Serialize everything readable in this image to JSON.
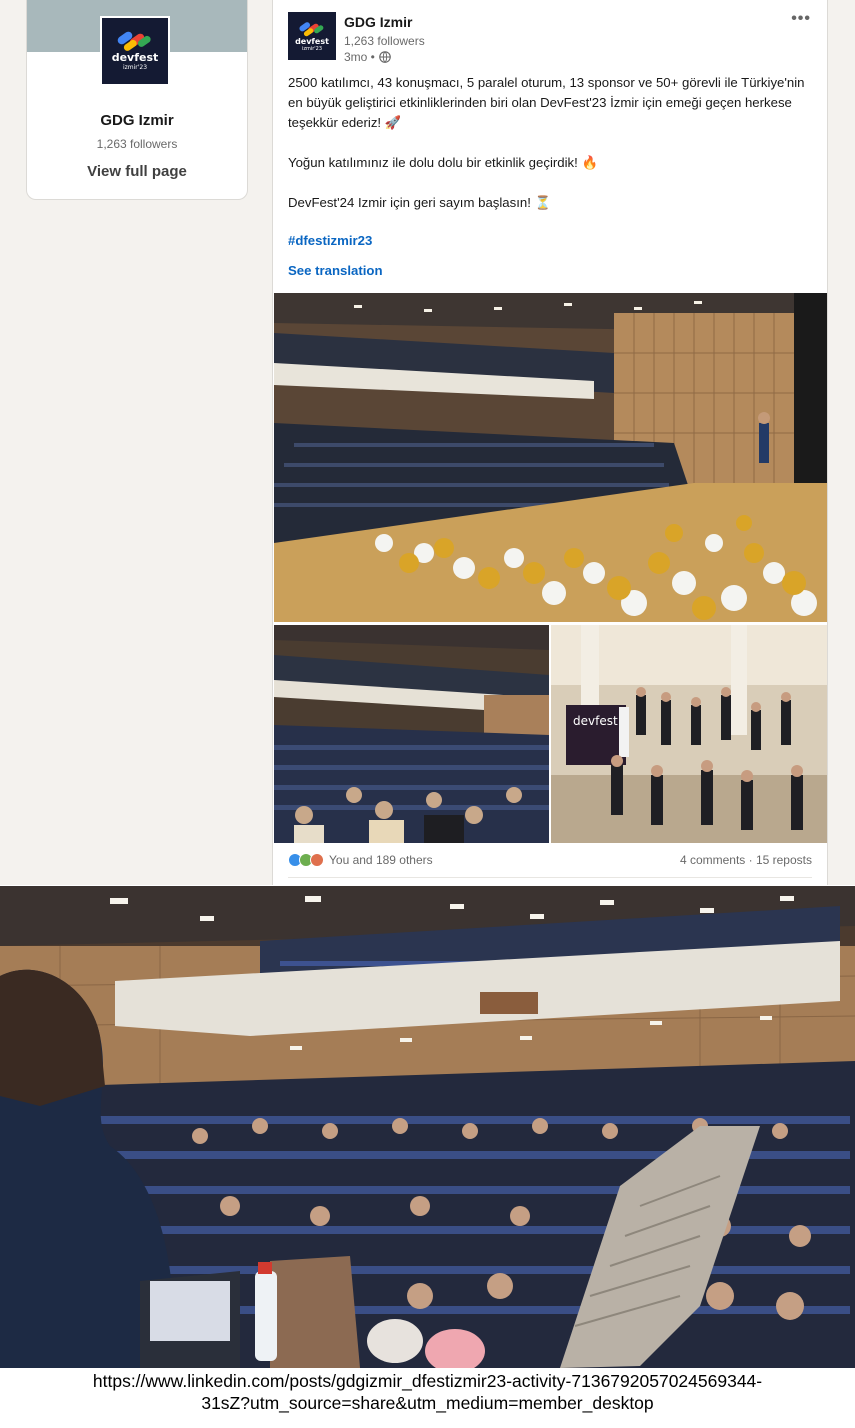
{
  "profile_card": {
    "name": "GDG Izmir",
    "followers": "1,263 followers",
    "view_link": "View full page",
    "logo_text": "devfest",
    "logo_subtext": "izmir'23"
  },
  "post": {
    "actor_name": "GDG Izmir",
    "actor_followers": "1,263 followers",
    "time": "3mo •",
    "more_label": "•••",
    "paragraphs": [
      "2500 katılımcı, 43 konuşmacı, 5 paralel oturum, 13 sponsor ve 50+ görevli ile Türkiye'nin en büyük geliştirici etkinliklerinden biri olan DevFest'23 İzmir için emeği geçen herkese teşekkür ederiz! 🚀",
      "Yoğun katılımınız ile dolu dolu bir etkinlik geçirdik! 🔥",
      "DevFest'24 Izmir için geri sayım başlasın! ⏳"
    ],
    "hashtag": "#dfestizmir23",
    "see_translation": "See translation",
    "reactions_text": "You and 189 others",
    "social_counts": "4 comments · 15 reposts",
    "images": [
      {
        "name": "auditorium-stage-balls-photo"
      },
      {
        "name": "auditorium-audience-photo"
      },
      {
        "name": "devfest-lobby-crowd-photo"
      }
    ]
  },
  "large_photo": {
    "name": "speaker-view-auditorium-photo"
  },
  "url_caption": {
    "line1": "https://www.linkedin.com/posts/gdgizmir_dfestizmir23-activity-7136792057024569344-",
    "line2": "31sZ?utm_source=share&utm_medium=member_desktop"
  },
  "colors": {
    "link_blue": "#0a66c2",
    "page_bg": "#f4f2ee",
    "logo_bg": "#141a33"
  }
}
